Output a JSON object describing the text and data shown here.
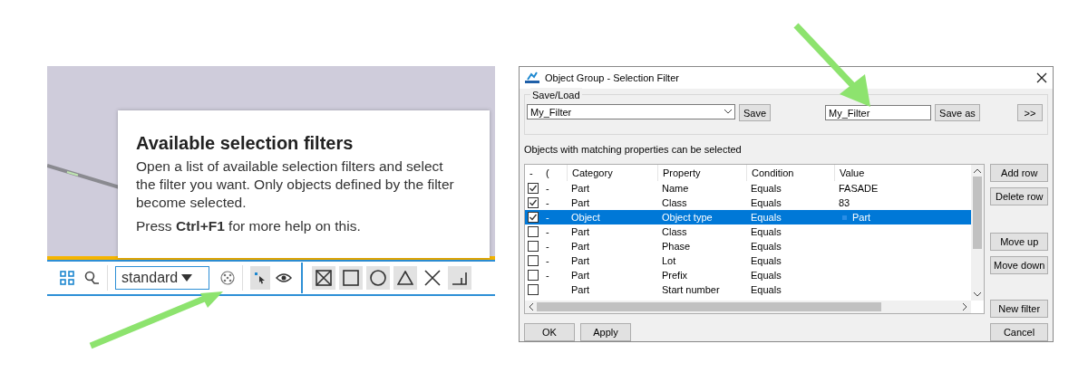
{
  "tooltip": {
    "title": "Available selection filters",
    "body": "Open a list of available selection filters and select the filter you want. Only objects defined by the filter become selected.",
    "hint": "Press **Ctrl+F1** for more help on this."
  },
  "toolbar": {
    "filter_dropdown": {
      "value": "standard"
    }
  },
  "dialog": {
    "title": "Object Group - Selection Filter",
    "save_load": {
      "label": "Save/Load",
      "filter_select": {
        "value": "My_Filter"
      },
      "save_button": "Save",
      "name_field": {
        "value": "My_Filter"
      },
      "save_as_button": "Save as",
      "more_button": ">>"
    },
    "caption": "Objects with matching properties can be selected",
    "table": {
      "columns": [
        "-",
        "(",
        "Category",
        "Property",
        "Condition",
        "Value"
      ],
      "rows": [
        {
          "checked": true,
          "selected": false,
          "cells": [
            "",
            "-",
            "Part",
            "Name",
            "Equals",
            "FASADE"
          ]
        },
        {
          "checked": true,
          "selected": false,
          "cells": [
            "",
            "-",
            "Part",
            "Class",
            "Equals",
            "83"
          ]
        },
        {
          "checked": true,
          "selected": true,
          "cells": [
            "",
            "-",
            "Object",
            "Object type",
            "Equals",
            "Part"
          ]
        },
        {
          "checked": false,
          "selected": false,
          "cells": [
            "",
            "-",
            "Part",
            "Class",
            "Equals",
            ""
          ]
        },
        {
          "checked": false,
          "selected": false,
          "cells": [
            "",
            "-",
            "Part",
            "Phase",
            "Equals",
            ""
          ]
        },
        {
          "checked": false,
          "selected": false,
          "cells": [
            "",
            "-",
            "Part",
            "Lot",
            "Equals",
            ""
          ]
        },
        {
          "checked": false,
          "selected": false,
          "cells": [
            "",
            "-",
            "Part",
            "Prefix",
            "Equals",
            ""
          ]
        },
        {
          "checked": false,
          "selected": false,
          "cells": [
            "",
            "",
            "Part",
            "Start number",
            "Equals",
            ""
          ]
        }
      ]
    },
    "side_buttons": [
      "Add row",
      "Delete row",
      "Move up",
      "Move down",
      "New filter"
    ],
    "bottom_buttons": [
      "OK",
      "Apply"
    ],
    "cancel_button": "Cancel"
  }
}
